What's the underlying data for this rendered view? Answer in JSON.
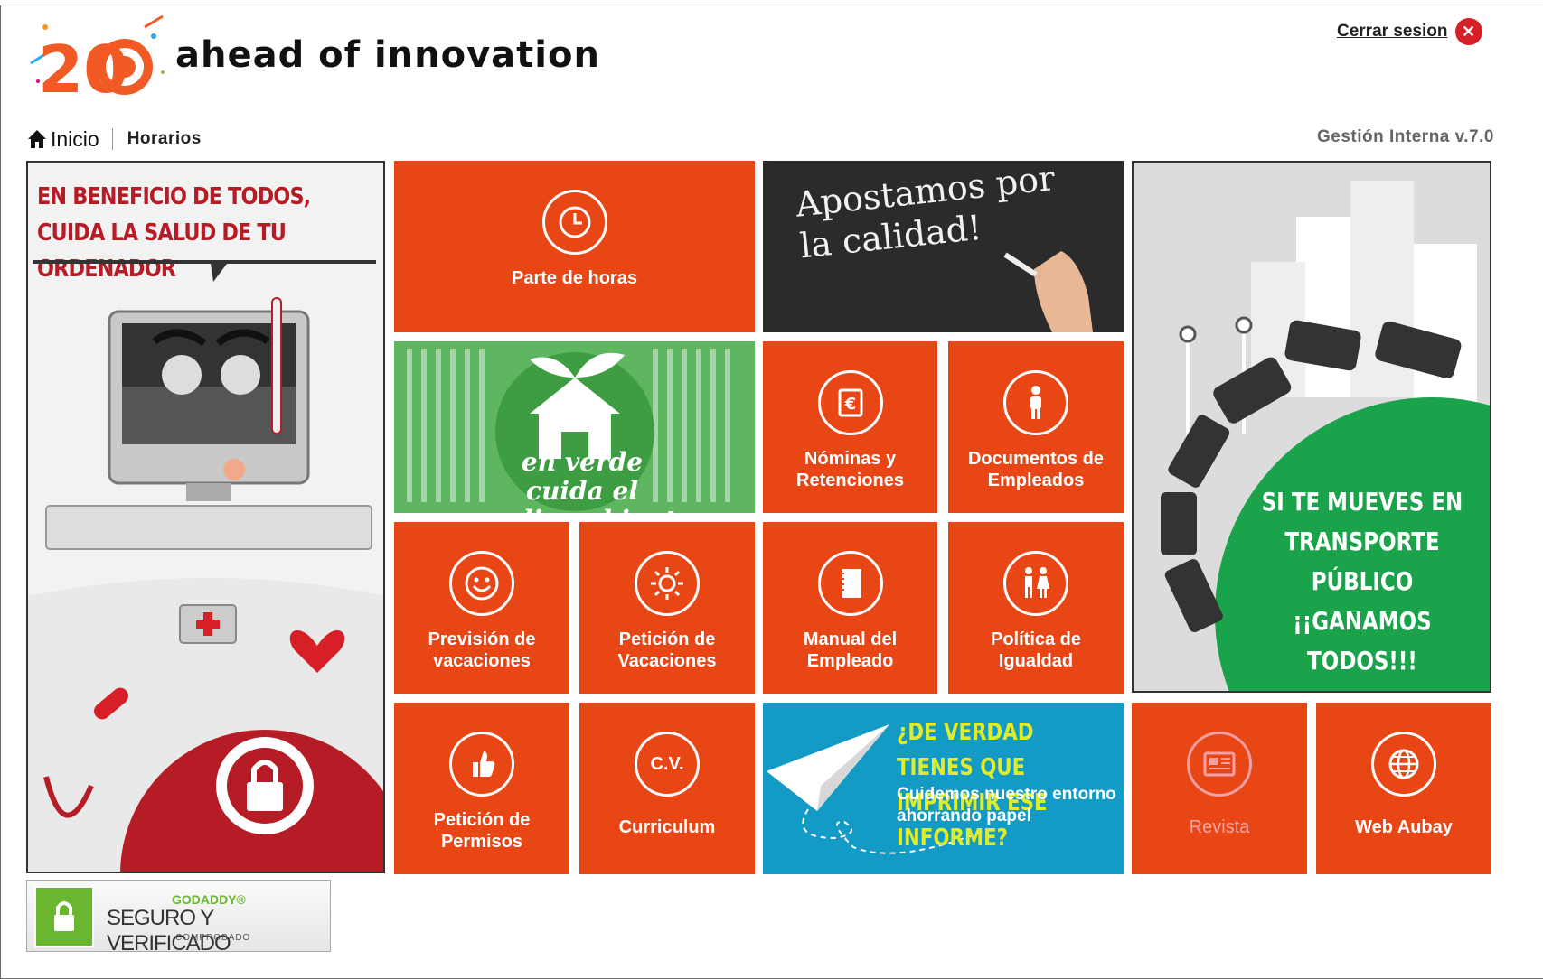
{
  "header": {
    "logo_text": "20",
    "slogan": "ahead of innovation",
    "logout_label": "Cerrar sesion",
    "version": "Gestión Interna v.7.0"
  },
  "breadcrumb": {
    "home": "Inicio",
    "current": "Horarios"
  },
  "tiles": {
    "parte_horas": "Parte de horas",
    "nominas": "Nóminas y\nRetenciones",
    "documentos": "Documentos de\nEmpleados",
    "prevision": "Previsión de\nvacaciones",
    "peticion_vacaciones": "Petición de\nVacaciones",
    "manual": "Manual del\nEmpleado",
    "politica": "Política de\nIgualdad",
    "permisos": "Petición de\nPermisos",
    "curriculum": "Curriculum",
    "curriculum_icon_text": "C.V.",
    "revista": "Revista",
    "web": "Web Aubay"
  },
  "banners": {
    "health_title": "EN BENEFICIO DE TODOS,\nCUIDA LA SALUD DE TU ORDENADOR",
    "calidad": "Apostamos por\nla calidad!",
    "verde": "en verde\ncuida el medioambiente",
    "transporte": "SI TE MUEVES EN\nTRANSPORTE PÚBLICO\n¡¡GANAMOS TODOS!!!",
    "imprimir_title": "¿DE VERDAD TIENES QUE\nIMPRIMIR ESE INFORME?",
    "imprimir_sub": "Cuidemos nuestro entorno\nahorrando papel"
  },
  "godaddy": {
    "top": "GODADDY®",
    "main": "SEGURO Y VERIFICADO",
    "sub": "COMPROBADO"
  },
  "colors": {
    "tile": "#e84615",
    "brand_red": "#d71f27",
    "green": "#5fb661",
    "blue": "#139ac5"
  }
}
